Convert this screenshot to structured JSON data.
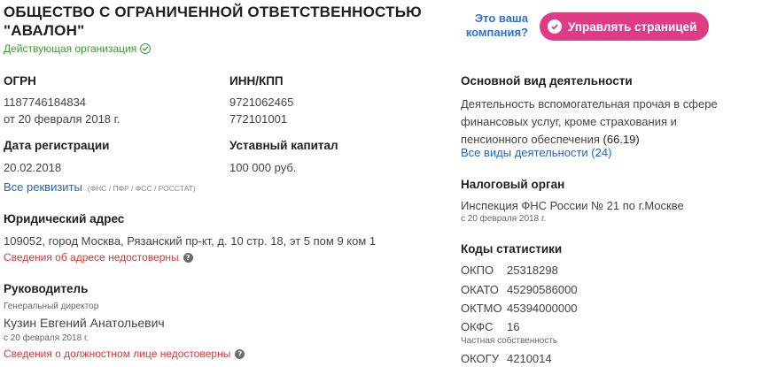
{
  "company": {
    "name_line1": "ОБЩЕСТВО С ОГРАНИЧЕННОЙ ОТВЕТСТВЕННОСТЬЮ",
    "name_line2": "\"АВАЛОН\"",
    "status": "Действующая организация"
  },
  "owner_prompt": {
    "ask_line1": "Это ваша",
    "ask_line2": "компания?",
    "button_label": "Управлять страницей"
  },
  "ogrn": {
    "label": "ОГРН",
    "value": "1187746184834",
    "date": "от 20 февраля 2018 г."
  },
  "inn_kpp": {
    "label": "ИНН/КПП",
    "inn": "9721062465",
    "kpp": "772101001"
  },
  "registration": {
    "label": "Дата регистрации",
    "value": "20.02.2018"
  },
  "capital": {
    "label": "Уставный капитал",
    "value": "100 000 руб."
  },
  "requisites": {
    "link": "Все реквизиты",
    "note": "(ФНС / ПФР / ФСС / РОССТАТ)"
  },
  "address": {
    "label": "Юридический адрес",
    "value": "109052, город Москва, Рязанский пр-кт, д. 10 стр. 18, эт 5 пом 9 ком 1",
    "warning": "Сведения об адресе недостоверны"
  },
  "director": {
    "label": "Руководитель",
    "position": "Генеральный директор",
    "name": "Кузин Евгений Анатольевич",
    "since": "с 20 февраля 2018 г.",
    "warning": "Сведения о должностном лице недостоверны"
  },
  "activity": {
    "label": "Основной вид деятельности",
    "line1": "Деятельность вспомогательная прочая в сфере",
    "line2": "финансовых услуг, кроме страхования и",
    "line3": "пенсионного обеспечения",
    "code": "(66.19)",
    "all_link": "Все виды деятельности (24)"
  },
  "tax": {
    "label": "Налоговый орган",
    "value": "Инспекция ФНС России № 21 по г.Москве",
    "since": "с 20 февраля 2018 г."
  },
  "stats": {
    "label": "Коды статистики",
    "codes": [
      {
        "key": "ОКПО",
        "value": "25318298"
      },
      {
        "key": "ОКАТО",
        "value": "45290586000"
      },
      {
        "key": "ОКТМО",
        "value": "45394000000"
      },
      {
        "key": "ОКФС",
        "value": "16"
      },
      {
        "key": "ОКОГУ",
        "value": "4210014"
      }
    ],
    "okfs_note": "Частная собственность"
  }
}
